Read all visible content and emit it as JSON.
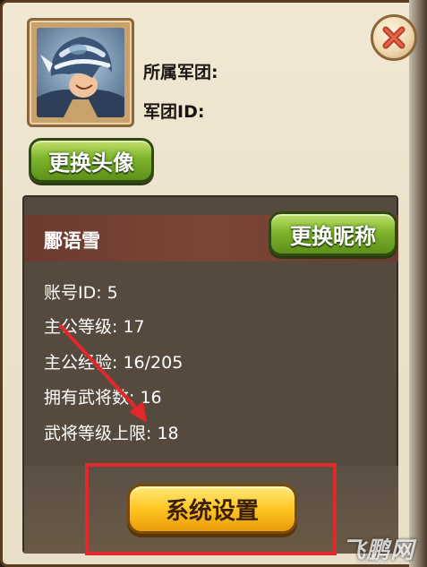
{
  "profile": {
    "legion_label": "所属军团:",
    "legion_id_label": "军团ID:",
    "change_avatar_label": "更换头像",
    "close_icon": "close-x-icon",
    "avatar_icon": "hero-helmet-portrait"
  },
  "stats": {
    "player_name": "酈语雪",
    "change_nickname_label": "更换昵称",
    "rows": [
      "账号ID: 5",
      "主公等级: 17",
      "主公经验: 16/205",
      "拥有武将数: 16",
      "武将等级上限: 18"
    ]
  },
  "footer": {
    "settings_label": "系统设置"
  },
  "annotation": {
    "highlight_color": "#e2282b",
    "arrow_color": "#e2282b"
  },
  "watermark": {
    "brand": "飞鹏网",
    "site": "www.FPWAP.com"
  }
}
